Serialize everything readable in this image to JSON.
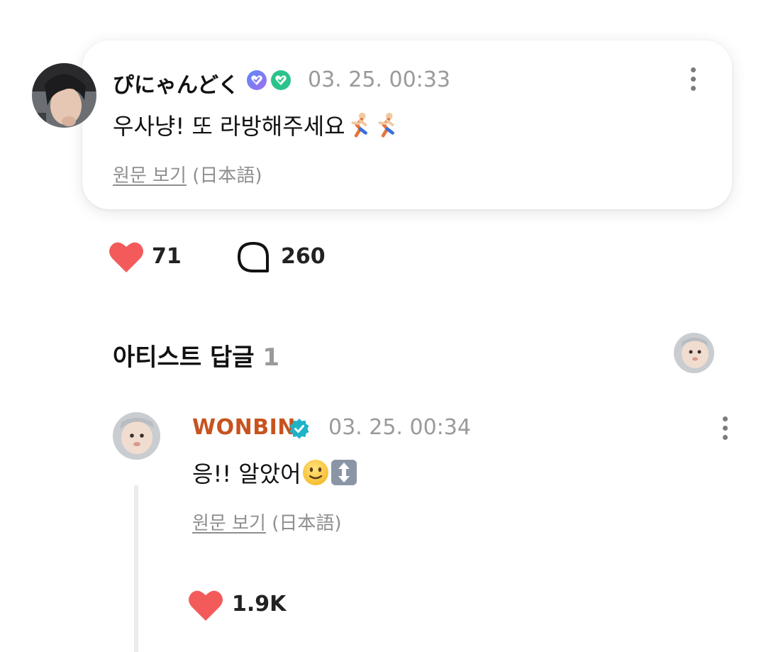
{
  "post": {
    "author": "ぴにゃんどく",
    "timestamp": "03. 25. 00:33",
    "text": "우사냥! 또 라방해주세요",
    "translate_link": "원문 보기",
    "language": "(日本語)",
    "likes": "71",
    "replies": "260"
  },
  "artist_section": {
    "title": "아티스트 답글",
    "count": "1"
  },
  "reply": {
    "author": "WONBIN",
    "timestamp": "03. 25. 00:34",
    "text": "응!! 알았어",
    "translate_link": "원문 보기",
    "language": "(日本語)",
    "likes": "1.9K"
  },
  "icons": {
    "badges": [
      "badge-blue-heart-icon",
      "badge-green-heart-icon"
    ],
    "post_emojis": [
      "runner-emoji-icon",
      "runner-emoji-icon"
    ],
    "reply_emojis": [
      "smiling-face-emoji-icon",
      "up-down-arrow-emoji-icon"
    ],
    "verified": "verified-check-icon",
    "like": "heart-icon",
    "comment": "speech-bubble-icon",
    "more": "more-options-icon"
  },
  "colors": {
    "heart": "#f35b5b",
    "artist_name": "#c8531f",
    "verified": "#1fb3c7",
    "timestamp": "#9a9a9a"
  }
}
